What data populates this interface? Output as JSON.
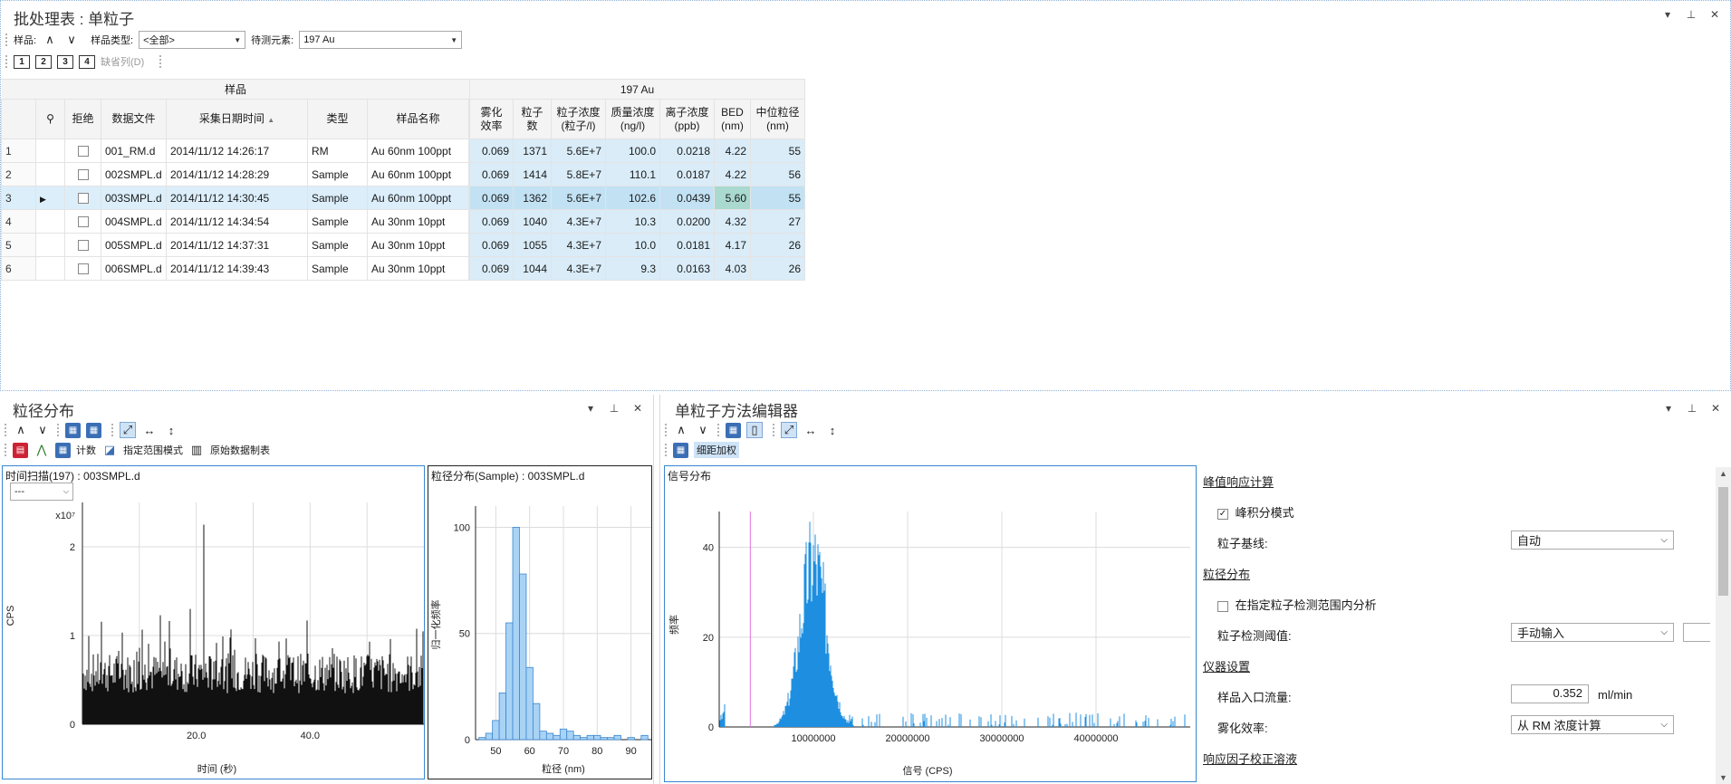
{
  "batch": {
    "title": "批处理表 : 单粒子",
    "sample_label": "样品:",
    "sample_type_label": "样品类型:",
    "sample_type_value": "<全部>",
    "element_label": "待测元素:",
    "element_value": "197  Au",
    "view_buttons": [
      "1",
      "2",
      "3",
      "4"
    ],
    "omit_col": "缺省列(D)",
    "group_sample": "样品",
    "group_element": "197  Au",
    "columns": {
      "reject": "拒绝",
      "file": "数据文件",
      "date": "采集日期时间",
      "type": "类型",
      "name": "样品名称",
      "neb1": "雾化",
      "neb2": "效率",
      "pc1": "粒子",
      "pc2": "数",
      "conc1": "粒子浓度",
      "conc2": "(粒子/l)",
      "mass1": "质量浓度",
      "mass2": "(ng/l)",
      "ion1": "离子浓度",
      "ion2": "(ppb)",
      "bed1": "BED",
      "bed2": "(nm)",
      "med1": "中位粒径",
      "med2": "(nm)"
    },
    "rows": [
      {
        "idx": "1",
        "file": "001_RM.d",
        "date": "2014/11/12 14:26:17",
        "type": "RM",
        "name": "Au 60nm 100ppt",
        "neb": "0.069",
        "pc": "1371",
        "conc": "5.6E+7",
        "mass": "100.0",
        "ion": "0.0218",
        "bed": "4.22",
        "med": "55"
      },
      {
        "idx": "2",
        "file": "002SMPL.d",
        "date": "2014/11/12 14:28:29",
        "type": "Sample",
        "name": "Au 60nm 100ppt",
        "neb": "0.069",
        "pc": "1414",
        "conc": "5.8E+7",
        "mass": "110.1",
        "ion": "0.0187",
        "bed": "4.22",
        "med": "56"
      },
      {
        "idx": "3",
        "file": "003SMPL.d",
        "date": "2014/11/12 14:30:45",
        "type": "Sample",
        "name": "Au 60nm 100ppt",
        "neb": "0.069",
        "pc": "1362",
        "conc": "5.6E+7",
        "mass": "102.6",
        "ion": "0.0439",
        "bed": "5.60",
        "med": "55"
      },
      {
        "idx": "4",
        "file": "004SMPL.d",
        "date": "2014/11/12 14:34:54",
        "type": "Sample",
        "name": "Au 30nm 10ppt",
        "neb": "0.069",
        "pc": "1040",
        "conc": "4.3E+7",
        "mass": "10.3",
        "ion": "0.0200",
        "bed": "4.32",
        "med": "27"
      },
      {
        "idx": "5",
        "file": "005SMPL.d",
        "date": "2014/11/12 14:37:31",
        "type": "Sample",
        "name": "Au 30nm 10ppt",
        "neb": "0.069",
        "pc": "1055",
        "conc": "4.3E+7",
        "mass": "10.0",
        "ion": "0.0181",
        "bed": "4.17",
        "med": "26"
      },
      {
        "idx": "6",
        "file": "006SMPL.d",
        "date": "2014/11/12 14:39:43",
        "type": "Sample",
        "name": "Au 30nm 10ppt",
        "neb": "0.069",
        "pc": "1044",
        "conc": "4.3E+7",
        "mass": "9.3",
        "ion": "0.0163",
        "bed": "4.03",
        "med": "26"
      }
    ]
  },
  "psd": {
    "title": "粒径分布",
    "count_label": "计数",
    "range_mode_label": "指定范围模式",
    "raw_table_label": "原始数据制表",
    "time_scan_title": "时间扫描(197) : 003SMPL.d",
    "time_scan_select": "---",
    "dist_title": "粒径分布(Sample) : 003SMPL.d"
  },
  "editor": {
    "title": "单粒子方法编辑器",
    "weight_label": "细距加权",
    "signal_title": "信号分布",
    "sections": {
      "peak": "峰值响应计算",
      "dist": "粒径分布",
      "instrument": "仪器设置",
      "rf": "响应因子校正溶液"
    },
    "peak_integration": "峰积分模式",
    "particle_baseline": "粒子基线:",
    "baseline_value": "自动",
    "analyze_in_range": "在指定粒子检测范围内分析",
    "detect_threshold": "粒子检测阈值:",
    "threshold_value": "手动输入",
    "flow_label": "样品入口流量:",
    "flow_value": "0.352",
    "flow_unit": "ml/min",
    "neb_label": "雾化效率:",
    "neb_value": "从 RM 浓度计算"
  },
  "chart_data": [
    {
      "type": "bar",
      "title": "时间扫描(197) : 003SMPL.d",
      "xlabel": "时间 (秒)",
      "ylabel": "CPS",
      "y_multiplier": "x10⁷",
      "x_ticks": [
        "20.0",
        "40.0"
      ],
      "y_ticks": [
        "0",
        "1",
        "2"
      ],
      "xlim": [
        0,
        60
      ],
      "ylim": [
        0,
        2.5
      ],
      "note": "dense spike trace"
    },
    {
      "type": "bar",
      "title": "粒径分布(Sample) : 003SMPL.d",
      "xlabel": "粒径 (nm)",
      "ylabel": "归一化频率",
      "x_ticks": [
        "50",
        "60",
        "70",
        "80",
        "90"
      ],
      "y_ticks": [
        "0",
        "50",
        "100"
      ],
      "xlim": [
        44,
        96
      ],
      "ylim": [
        0,
        110
      ],
      "bins": [
        46,
        48,
        50,
        52,
        54,
        56,
        58,
        60,
        62,
        64,
        66,
        68,
        70,
        72,
        74,
        76,
        78,
        80,
        82,
        84,
        86,
        88,
        90,
        92,
        94
      ],
      "values": [
        1,
        3,
        9,
        22,
        55,
        100,
        78,
        34,
        17,
        4,
        3,
        2,
        5,
        4,
        2,
        1,
        2,
        2,
        1,
        1,
        2,
        0,
        1,
        0,
        2
      ]
    },
    {
      "type": "bar",
      "title": "信号分布",
      "xlabel": "信号 (CPS)",
      "ylabel": "频率",
      "x_ticks": [
        "10000000",
        "20000000",
        "30000000",
        "40000000"
      ],
      "y_ticks": [
        "0",
        "20",
        "40"
      ],
      "xlim": [
        0,
        50000000
      ],
      "ylim": [
        0,
        48
      ],
      "threshold_x": 3300000
    }
  ]
}
